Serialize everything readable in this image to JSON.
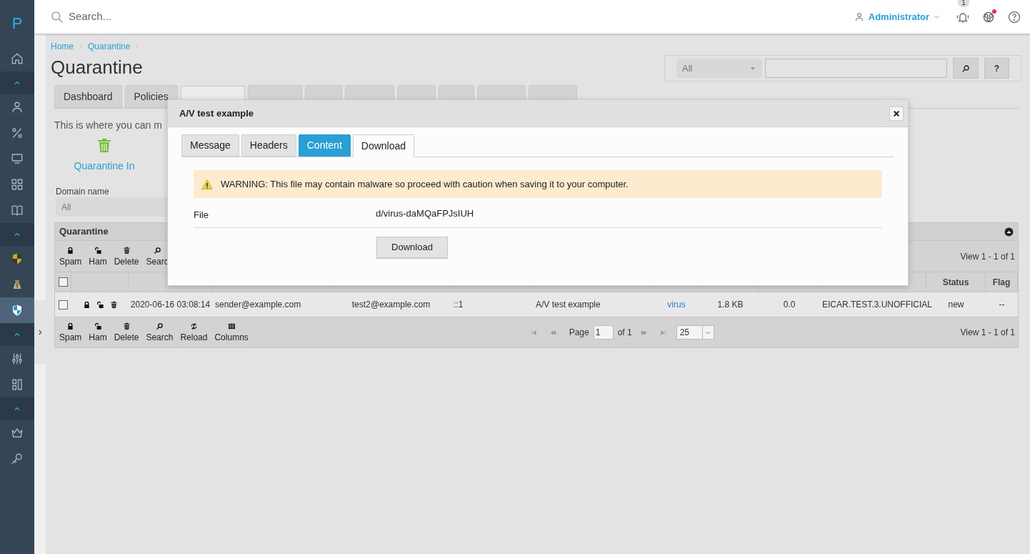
{
  "sidebar": {
    "logo": "P",
    "items": [
      {
        "kind": "nav",
        "selected": false
      },
      {
        "kind": "section",
        "expanded": true
      },
      {
        "kind": "nav",
        "selected": false
      },
      {
        "kind": "nav",
        "selected": false
      },
      {
        "kind": "nav",
        "selected": false
      },
      {
        "kind": "nav",
        "selected": false
      },
      {
        "kind": "nav",
        "selected": false
      },
      {
        "kind": "section",
        "expanded": true
      },
      {
        "kind": "nav",
        "selected": false
      },
      {
        "kind": "nav",
        "selected": false
      },
      {
        "kind": "nav",
        "selected": true
      },
      {
        "kind": "section",
        "expanded": true
      },
      {
        "kind": "nav",
        "selected": false
      },
      {
        "kind": "nav",
        "selected": false
      },
      {
        "kind": "section",
        "expanded": true
      },
      {
        "kind": "nav",
        "selected": false
      },
      {
        "kind": "nav",
        "selected": false
      }
    ]
  },
  "topbar": {
    "search_placeholder": "Search...",
    "user": "Administrator",
    "notification_count": "1",
    "alert": true
  },
  "breadcrumb": [
    "Home",
    "Quarantine"
  ],
  "title": "Quarantine",
  "search_panel": {
    "scope": "All",
    "help": "?"
  },
  "tabs": [
    {
      "label": "Dashboard",
      "selected": false
    },
    {
      "label": "Policies",
      "selected": false
    },
    {
      "selected": true
    },
    {
      "selected": false
    },
    {
      "selected": false
    },
    {
      "selected": false
    },
    {
      "selected": false
    },
    {
      "selected": false
    },
    {
      "selected": false
    },
    {
      "selected": false
    }
  ],
  "description": "This is where you can m",
  "actions": [
    {
      "label": "Quarantine In"
    }
  ],
  "filter": {
    "label": "Domain name",
    "value": "All"
  },
  "grid": {
    "title": "Quarantine",
    "expanded": true,
    "top_toolbar": [
      "Spam",
      "Ham",
      "Delete",
      "Searc"
    ],
    "view_info": "View 1 - 1 of 1",
    "all_checked": false,
    "columns": [
      null,
      null,
      null,
      null,
      null,
      null,
      null,
      null,
      null,
      {
        "label": "Status"
      },
      {
        "label": "Flag"
      }
    ],
    "rows": [
      {
        "checked": false,
        "cells": [
          "2020-06-16 03:08:14",
          "sender@example.com",
          "test2@example.com",
          "::1",
          "A/V test example",
          "virus",
          "1.8 KB",
          "0.0",
          "EICAR.TEST.3.UNOFFICIAL",
          "new",
          "--"
        ]
      }
    ],
    "bottom_toolbar": [
      "Spam",
      "Ham",
      "Delete",
      "Search",
      "Reload",
      "Columns"
    ],
    "pager": {
      "page_label": "Page",
      "page": "1",
      "of": "of 1",
      "page_size": "25"
    },
    "view_info_bottom": "View 1 - 1 of 1"
  },
  "modal": {
    "title": "A/V test example",
    "tabs": [
      {
        "label": "Message",
        "selected": false,
        "hovered": false
      },
      {
        "label": "Headers",
        "selected": false,
        "hovered": false
      },
      {
        "label": "Content",
        "selected": false,
        "hovered": true
      },
      {
        "label": "Download",
        "selected": true,
        "hovered": false
      }
    ],
    "warning": "WARNING: This file may contain malware so proceed with caution when saving it to your computer.",
    "field_label": "File",
    "field_value": "d/virus-daMQaFPJsIUH",
    "button": "Download"
  }
}
